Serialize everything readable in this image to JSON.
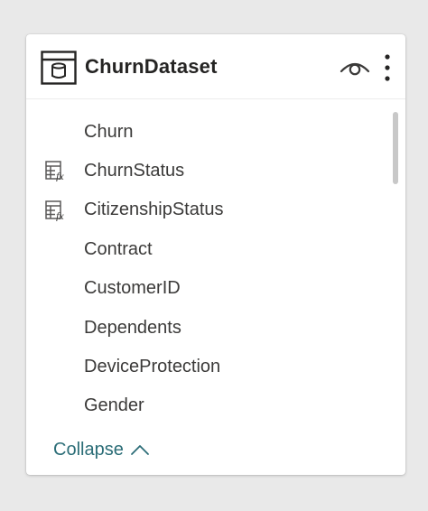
{
  "dataset": {
    "title": "ChurnDataset",
    "fields": [
      {
        "label": "Churn",
        "icon": ""
      },
      {
        "label": "ChurnStatus",
        "icon": "calculated-column-icon"
      },
      {
        "label": "CitizenshipStatus",
        "icon": "calculated-column-icon"
      },
      {
        "label": "Contract",
        "icon": ""
      },
      {
        "label": "CustomerID",
        "icon": ""
      },
      {
        "label": "Dependents",
        "icon": ""
      },
      {
        "label": "DeviceProtection",
        "icon": ""
      },
      {
        "label": "Gender",
        "icon": ""
      }
    ],
    "collapse_label": "Collapse"
  },
  "colors": {
    "link": "#2b6d77",
    "title": "#252423",
    "text": "#3b3a39"
  }
}
